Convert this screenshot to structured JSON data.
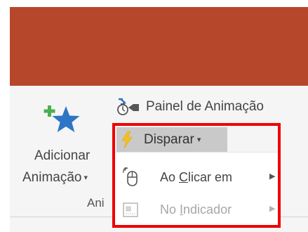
{
  "ribbon": {
    "add_animation": {
      "line1": "Adicionar",
      "line2": "Animação",
      "caret": "▾",
      "icon": "add-animation-star-icon"
    },
    "animation_pane": {
      "label": "Painel de Animação",
      "icon": "animation-pane-icon"
    },
    "trigger": {
      "label": "Disparar",
      "caret": "▾",
      "icon": "lightning-bolt-icon"
    },
    "group_label": "Ani"
  },
  "trigger_menu": {
    "items": [
      {
        "label_pre": "Ao ",
        "label_key": "C",
        "label_post": "licar em",
        "arrow": "▶",
        "enabled": true,
        "icon": "mouse-click-icon"
      },
      {
        "label_pre": "No ",
        "label_key": "I",
        "label_post": "ndicador",
        "arrow": "▶",
        "enabled": false,
        "icon": "bookmark-indicator-icon"
      }
    ]
  },
  "colors": {
    "title_bar": "#b7472a",
    "ribbon_bg": "#f5f5f5",
    "highlight_border": "#ee0000",
    "trigger_selected_bg": "#c9c9c9",
    "star_blue": "#2e75c5",
    "plus_green": "#4caf50",
    "bolt_yellow": "#f4c020"
  }
}
